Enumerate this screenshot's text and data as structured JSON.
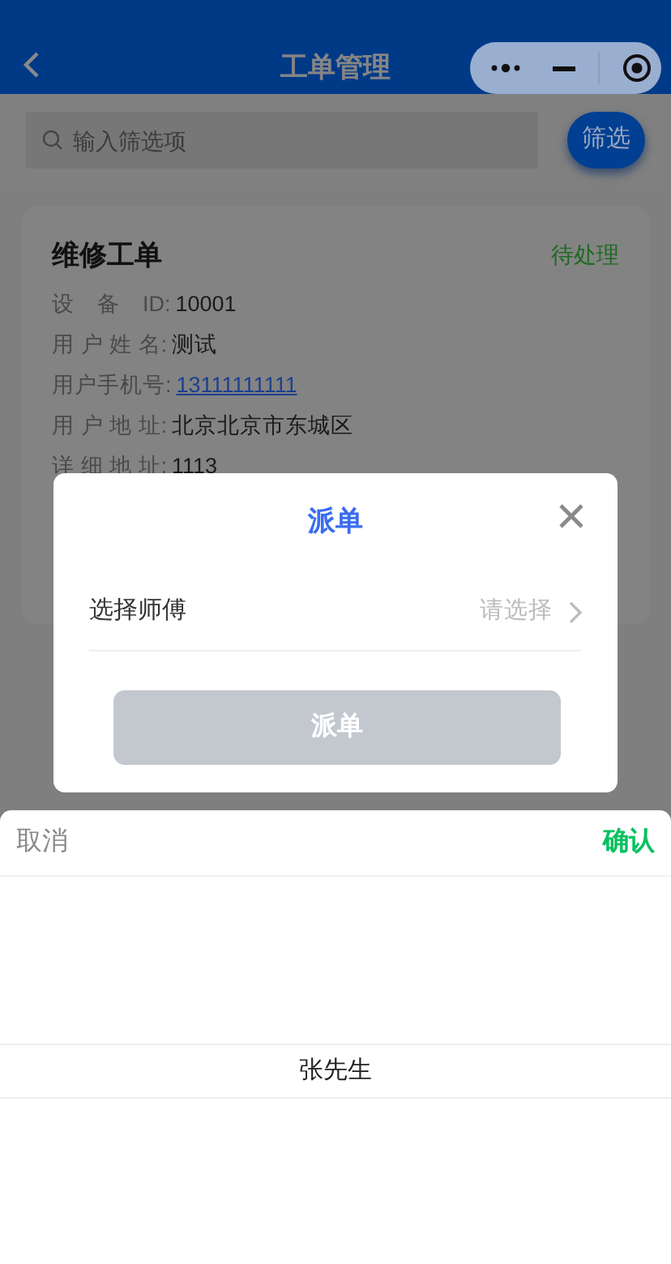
{
  "header": {
    "title": "工单管理"
  },
  "search": {
    "placeholder": "输入筛选项"
  },
  "filter_button": "筛选",
  "card": {
    "title": "维修工单",
    "status": "待处理",
    "fields": [
      {
        "label": "设　备　ID:",
        "value": "10001",
        "kind": "text"
      },
      {
        "label": "用 户 姓 名:",
        "value": "测试",
        "kind": "text"
      },
      {
        "label": "用户手机号:",
        "value": "13111111111",
        "kind": "link"
      },
      {
        "label": "用 户 地 址:",
        "value": "北京北京市东城区",
        "kind": "text"
      },
      {
        "label": "详 细 地 址:",
        "value": "1113",
        "kind": "text"
      }
    ]
  },
  "dialog": {
    "title": "派单",
    "field_label": "选择师傅",
    "field_placeholder": "请选择",
    "submit": "派单",
    "submit_disabled": true
  },
  "picker": {
    "cancel": "取消",
    "confirm": "确认",
    "options": [
      {
        "label": "张先生",
        "selected": true
      }
    ]
  }
}
